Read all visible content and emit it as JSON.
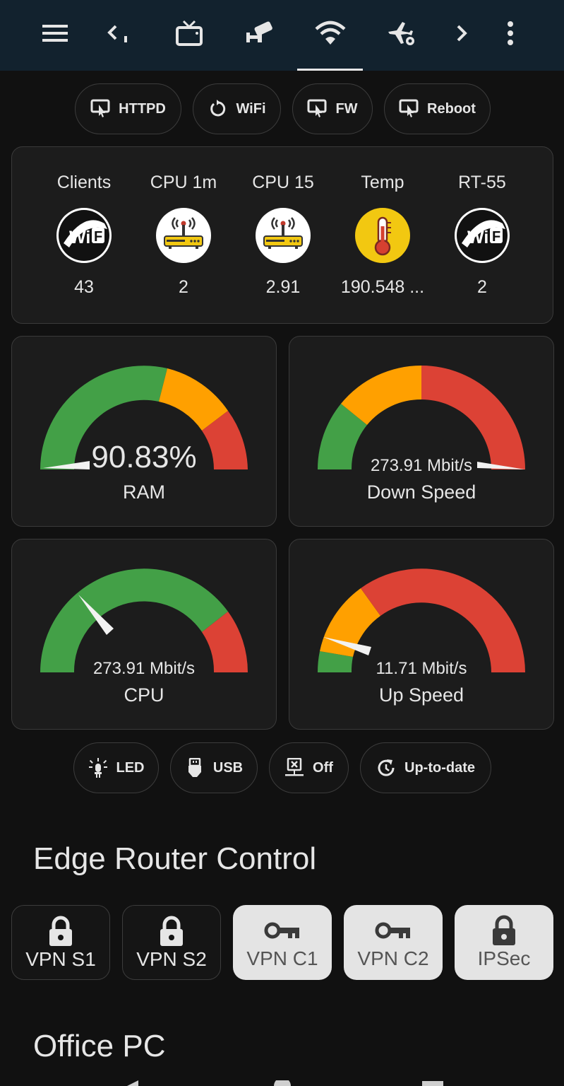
{
  "topbar": {
    "icons": [
      "menu-icon",
      "chevron-left-icon",
      "tv-icon",
      "cctv-camera-icon",
      "wifi-icon",
      "airplane-location-icon",
      "chevron-right-icon",
      "more-vertical-icon"
    ]
  },
  "actions": [
    {
      "label": "HTTPD",
      "icon": "remote-hand-icon"
    },
    {
      "label": "WiFi",
      "icon": "restart-icon"
    },
    {
      "label": "FW",
      "icon": "remote-hand-icon"
    },
    {
      "label": "Reboot",
      "icon": "remote-hand-icon"
    }
  ],
  "stats": [
    {
      "label": "Clients",
      "value": "43",
      "icon": "wifi-badge-icon"
    },
    {
      "label": "CPU 1m",
      "value": "2",
      "icon": "router-icon"
    },
    {
      "label": "CPU 15",
      "value": "2.91",
      "icon": "router-icon"
    },
    {
      "label": "Temp",
      "value": "190.548 ...",
      "icon": "thermometer-icon"
    },
    {
      "label": "RT-55",
      "value": "2",
      "icon": "wifi-badge-icon"
    }
  ],
  "gauges": [
    {
      "name": "RAM",
      "value_text": "90.83%",
      "level": 0.0
    },
    {
      "name": "Down Speed",
      "value_text": "273.91 Mbit/s",
      "level": 1.0
    },
    {
      "name": "CPU",
      "value_text": "273.91 Mbit/s",
      "level": 0.2
    },
    {
      "name": "Up Speed",
      "value_text": "11.71 Mbit/s",
      "level": 0.09
    }
  ],
  "status_chips": [
    {
      "label": "LED",
      "icon": "led-icon"
    },
    {
      "label": "USB",
      "icon": "usb-icon"
    },
    {
      "label": "Off",
      "icon": "network-off-icon"
    },
    {
      "label": "Up-to-date",
      "icon": "update-icon"
    }
  ],
  "sections": {
    "edge_router": "Edge Router Control",
    "office_pc": "Office PC"
  },
  "vpn": [
    {
      "label": "VPN S1",
      "icon": "lock-icon",
      "active": false
    },
    {
      "label": "VPN S2",
      "icon": "lock-icon",
      "active": false
    },
    {
      "label": "VPN C1",
      "icon": "key-icon",
      "active": true
    },
    {
      "label": "VPN C2",
      "icon": "key-icon",
      "active": true
    },
    {
      "label": "IPSec",
      "icon": "lock-icon",
      "active": true
    }
  ],
  "colors": {
    "topbar": "#12222e",
    "green": "#43a047",
    "orange": "#ffa000",
    "red": "#dc4235",
    "temp_yellow": "#f2c811"
  }
}
